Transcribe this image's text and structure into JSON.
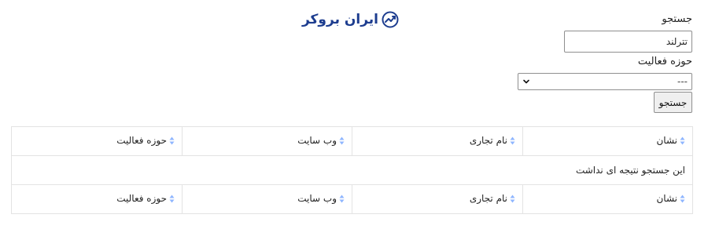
{
  "logo": {
    "text": "ایران بروکر",
    "color": "#1d3d8f"
  },
  "search": {
    "label": "جستجو",
    "value": "تترلند"
  },
  "activity_field": {
    "label": "حوزه فعالیت",
    "selected": "---"
  },
  "search_button": {
    "label": "جستجو"
  },
  "table": {
    "header": [
      "نشان",
      "نام تجاری",
      "وب سایت",
      "حوزه فعالیت"
    ],
    "empty_message": "این جستجو نتیجه ای نداشت",
    "footer": [
      "نشان",
      "نام تجاری",
      "وب سایت",
      "حوزه فعالیت"
    ]
  },
  "icons": {
    "logo": "trend-chart-icon",
    "select_arrow": "chevron-down-icon",
    "sort": "sort-icon"
  },
  "colors": {
    "sort_icon": "#8fb6ff",
    "border": "#e3e3e3"
  }
}
